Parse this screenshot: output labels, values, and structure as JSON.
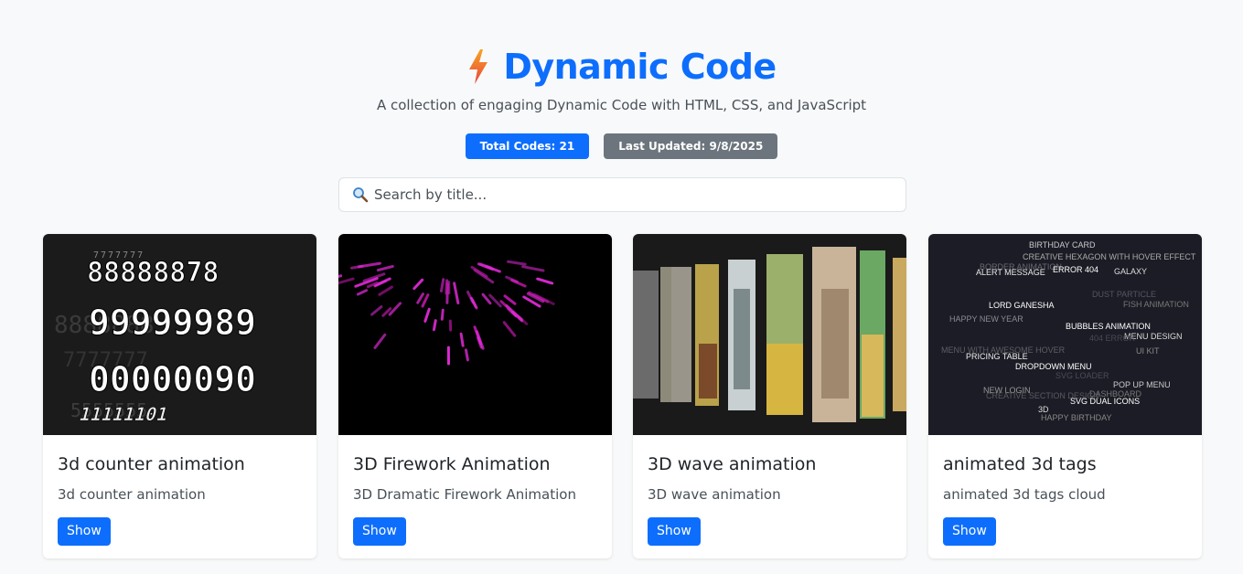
{
  "header": {
    "title": "Dynamic Code",
    "subtitle": "A collection of engaging Dynamic Code with HTML, CSS, and JavaScript",
    "badges": {
      "total": "Total Codes: 21",
      "updated": "Last Updated: 9/8/2025"
    }
  },
  "search": {
    "placeholder": "Search by title..."
  },
  "colors": {
    "accent": "#0d6efd",
    "badge_gray": "#6c757d",
    "background": "#f8f9fa"
  },
  "cards": [
    {
      "title": "3d counter animation",
      "description": "3d counter animation",
      "button": "Show",
      "preview_rows": [
        "88888878",
        "99999989",
        "00000090",
        "11111101"
      ]
    },
    {
      "title": "3D Firework Animation",
      "description": "3D Dramatic Firework Animation",
      "button": "Show"
    },
    {
      "title": "3D wave animation",
      "description": "3D wave animation",
      "button": "Show"
    },
    {
      "title": "animated 3d tags",
      "description": "animated 3d tags cloud",
      "button": "Show",
      "preview_tags": [
        "BIRTHDAY CARD",
        "CREATIVE HEXAGON WITH HOVER EFFECT",
        "BORDER ANIMATION",
        "ALERT MESSAGE",
        "ERROR 404",
        "GALAXY",
        "DUST PARTICLE",
        "FISH ANIMATION",
        "LORD GANESHA",
        "HAPPY NEW YEAR",
        "BUBBLES ANIMATION",
        "MENU DESIGN",
        "404 ERROR",
        "MENU WITH AWESOME HOVER",
        "UI KIT",
        "PRICING TABLE",
        "DROPDOWN MENU",
        "SVG LOADER",
        "POP UP MENU",
        "NEW LOGIN",
        "DASHBOARD",
        "CREATIVE SECTION DESIGN",
        "SVG DUAL ICONS",
        "3D",
        "HAPPY BIRTHDAY"
      ]
    }
  ]
}
